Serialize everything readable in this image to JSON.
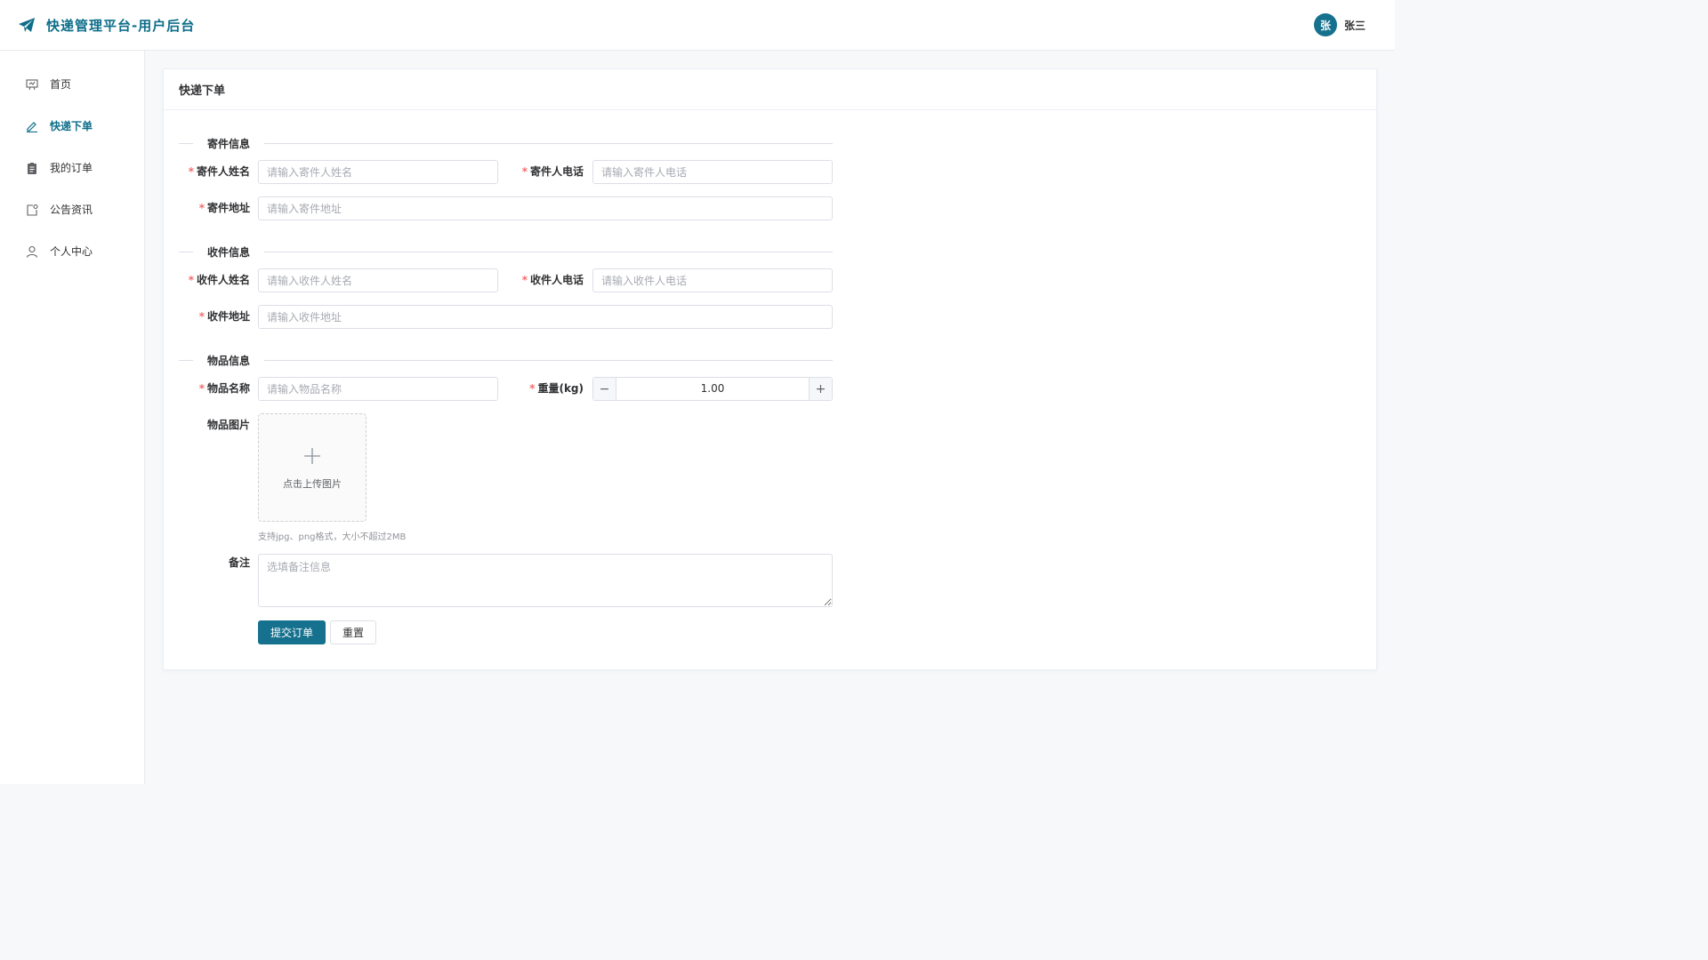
{
  "header": {
    "title": "快递管理平台-用户后台",
    "brand_color": "#0e6e8a",
    "user": {
      "avatar_text": "张",
      "name": "张三"
    }
  },
  "sidebar": {
    "items": [
      {
        "label": "首页",
        "icon": "presentation-icon",
        "active": false
      },
      {
        "label": "快递下单",
        "icon": "edit-pen-icon",
        "active": true
      },
      {
        "label": "我的订单",
        "icon": "clipboard-icon",
        "active": false
      },
      {
        "label": "公告资讯",
        "icon": "notice-icon",
        "active": false
      },
      {
        "label": "个人中心",
        "icon": "user-icon",
        "active": false
      }
    ]
  },
  "card": {
    "title": "快递下单"
  },
  "form": {
    "sender_section": "寄件信息",
    "sender_name": {
      "label": "寄件人姓名",
      "placeholder": "请输入寄件人姓名",
      "value": ""
    },
    "sender_phone": {
      "label": "寄件人电话",
      "placeholder": "请输入寄件人电话",
      "value": ""
    },
    "sender_address": {
      "label": "寄件地址",
      "placeholder": "请输入寄件地址",
      "value": ""
    },
    "receiver_section": "收件信息",
    "receiver_name": {
      "label": "收件人姓名",
      "placeholder": "请输入收件人姓名",
      "value": ""
    },
    "receiver_phone": {
      "label": "收件人电话",
      "placeholder": "请输入收件人电话",
      "value": ""
    },
    "receiver_address": {
      "label": "收件地址",
      "placeholder": "请输入收件地址",
      "value": ""
    },
    "item_section": "物品信息",
    "item_name": {
      "label": "物品名称",
      "placeholder": "请输入物品名称",
      "value": ""
    },
    "weight": {
      "label": "重量(kg)",
      "value": "1.00",
      "minus": "−",
      "plus": "+"
    },
    "image": {
      "label": "物品图片",
      "upload_text": "点击上传图片",
      "tip": "支持jpg、png格式，大小不超过2MB"
    },
    "remark": {
      "label": "备注",
      "placeholder": "选填备注信息",
      "value": ""
    },
    "required_mark": "*",
    "submit_label": "提交订单",
    "reset_label": "重置"
  },
  "colors": {
    "primary": "#15718e",
    "required": "#f56c6c"
  }
}
